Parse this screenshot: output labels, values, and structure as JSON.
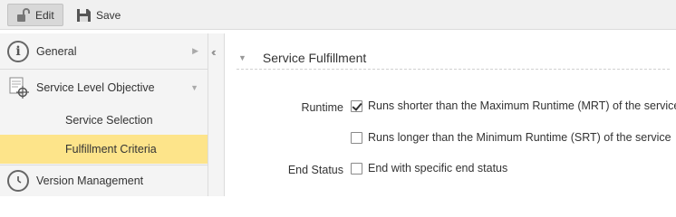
{
  "toolbar": {
    "edit_label": "Edit",
    "save_label": "Save"
  },
  "sidebar": {
    "items": [
      {
        "label": "General",
        "icon": "info-icon"
      },
      {
        "label": "Service Level Objective",
        "icon": "document-target-icon"
      },
      {
        "label": "Service Selection"
      },
      {
        "label": "Fulfillment Criteria",
        "selected": true
      },
      {
        "label": "Version Management",
        "icon": "clock-icon"
      }
    ]
  },
  "section": {
    "title": "Service Fulfillment"
  },
  "form": {
    "runtime_label": "Runtime",
    "runtime_options": [
      {
        "label": "Runs shorter than the Maximum Runtime (MRT) of the service",
        "checked": true
      },
      {
        "label": "Runs longer than the Minimum Runtime (SRT) of the service",
        "checked": false
      }
    ],
    "end_status_label": "End Status",
    "end_status_option": {
      "label": "End with specific end status",
      "checked": false
    }
  },
  "colors": {
    "selected_background": "#fde48a",
    "toolbar_background": "#f0f0f0",
    "sidebar_background": "#f4f4f4"
  }
}
